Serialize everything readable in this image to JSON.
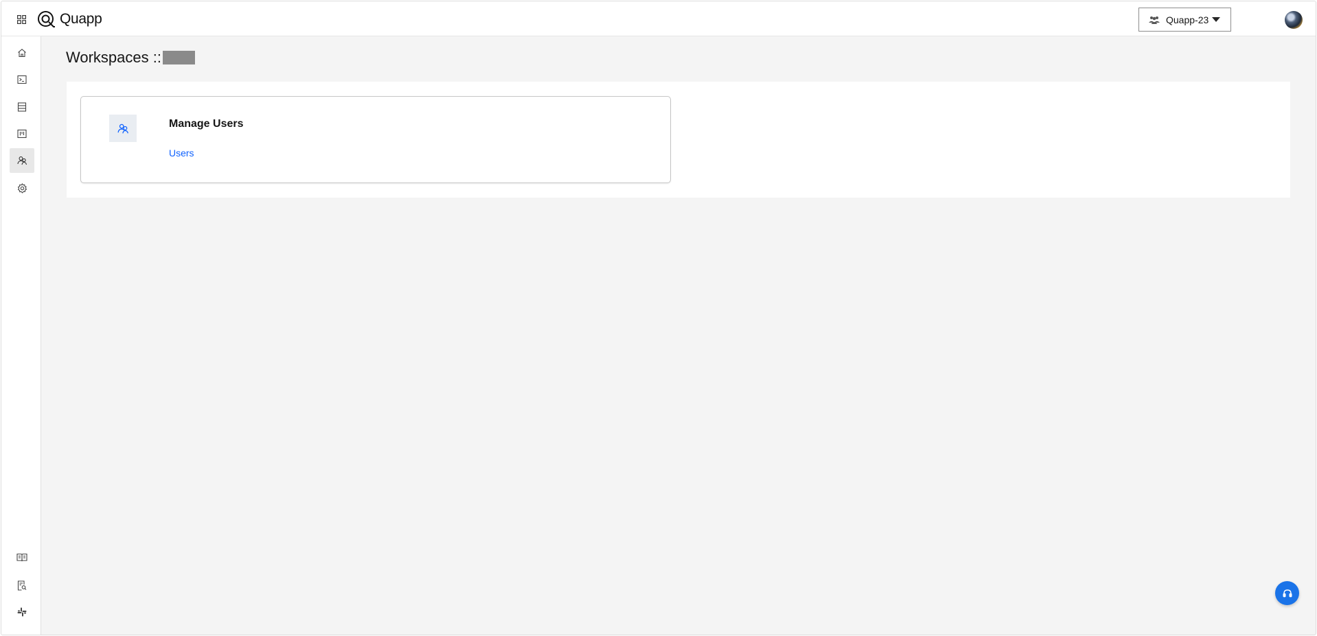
{
  "header": {
    "app_name": "Quapp",
    "workspace_selector": {
      "label": "Quapp-23"
    }
  },
  "sidebar": {
    "top_items": [
      {
        "icon": "home-icon"
      },
      {
        "icon": "terminal-icon"
      },
      {
        "icon": "database-icon"
      },
      {
        "icon": "board-icon"
      },
      {
        "icon": "users-icon",
        "active": true
      },
      {
        "icon": "settings-icon"
      }
    ],
    "bottom_items": [
      {
        "icon": "book-icon"
      },
      {
        "icon": "document-search-icon"
      },
      {
        "icon": "slack-icon"
      }
    ]
  },
  "main": {
    "title": "Workspaces ::",
    "card": {
      "icon": "users-icon",
      "title": "Manage Users",
      "link": "Users"
    }
  },
  "help_button": {
    "icon": "headset-icon"
  },
  "colors": {
    "accent": "#0f62fe",
    "fab": "#1a73e8",
    "redaction": "#8a8a8a",
    "active_nav": "#e8e8e8"
  }
}
